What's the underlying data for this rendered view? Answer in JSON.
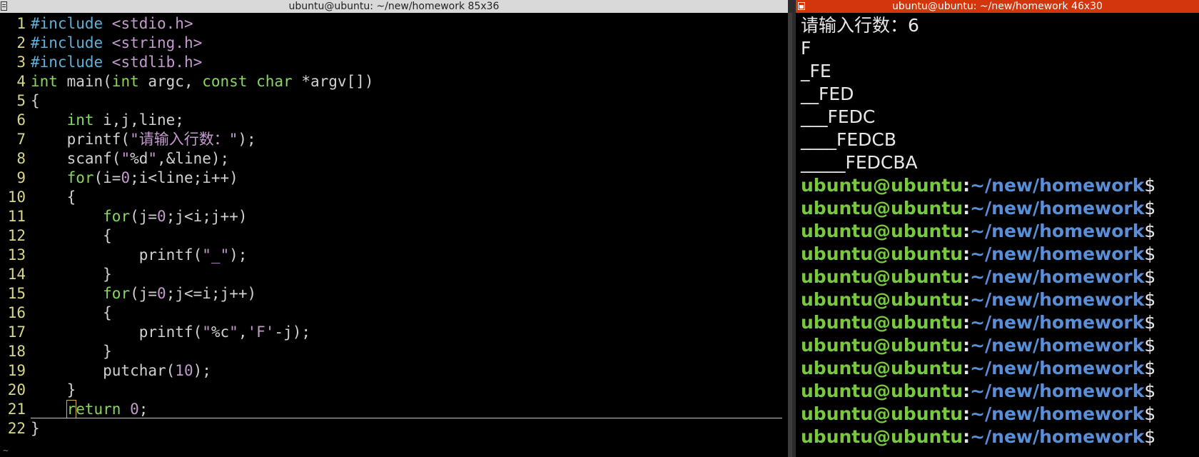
{
  "left_window": {
    "title": "ubuntu@ubuntu: ~/new/homework 85x36",
    "code_lines": [
      {
        "n": "1",
        "tokens": [
          {
            "t": "#include ",
            "c": "pre"
          },
          {
            "t": "<stdio.h>",
            "c": "str"
          }
        ]
      },
      {
        "n": "2",
        "tokens": [
          {
            "t": "#include ",
            "c": "pre"
          },
          {
            "t": "<string.h>",
            "c": "str"
          }
        ]
      },
      {
        "n": "3",
        "tokens": [
          {
            "t": "#include ",
            "c": "pre"
          },
          {
            "t": "<stdlib.h>",
            "c": "str"
          }
        ]
      },
      {
        "n": "4",
        "tokens": [
          {
            "t": "int",
            "c": "type"
          },
          {
            "t": " main(",
            "c": "plain"
          },
          {
            "t": "int",
            "c": "type"
          },
          {
            "t": " argc, ",
            "c": "plain"
          },
          {
            "t": "const",
            "c": "type"
          },
          {
            "t": " ",
            "c": "plain"
          },
          {
            "t": "char",
            "c": "type"
          },
          {
            "t": " *argv[])",
            "c": "plain"
          }
        ]
      },
      {
        "n": "5",
        "tokens": [
          {
            "t": "{",
            "c": "plain"
          }
        ]
      },
      {
        "n": "6",
        "tokens": [
          {
            "t": "    ",
            "c": "plain"
          },
          {
            "t": "int",
            "c": "type"
          },
          {
            "t": " i,j,line;",
            "c": "plain"
          }
        ]
      },
      {
        "n": "7",
        "tokens": [
          {
            "t": "    printf(",
            "c": "plain"
          },
          {
            "t": "\"请输入行数：\"",
            "c": "str"
          },
          {
            "t": ");",
            "c": "plain"
          }
        ]
      },
      {
        "n": "8",
        "tokens": [
          {
            "t": "    scanf(",
            "c": "plain"
          },
          {
            "t": "\"",
            "c": "str"
          },
          {
            "t": "%d",
            "c": "plain"
          },
          {
            "t": "\"",
            "c": "str"
          },
          {
            "t": ",&line);",
            "c": "plain"
          }
        ]
      },
      {
        "n": "9",
        "tokens": [
          {
            "t": "    ",
            "c": "plain"
          },
          {
            "t": "for",
            "c": "ctrl"
          },
          {
            "t": "(i=",
            "c": "plain"
          },
          {
            "t": "0",
            "c": "num"
          },
          {
            "t": ";i<line;i++)",
            "c": "plain"
          }
        ]
      },
      {
        "n": "10",
        "tokens": [
          {
            "t": "    {",
            "c": "plain"
          }
        ]
      },
      {
        "n": "11",
        "tokens": [
          {
            "t": "        ",
            "c": "plain"
          },
          {
            "t": "for",
            "c": "ctrl"
          },
          {
            "t": "(j=",
            "c": "plain"
          },
          {
            "t": "0",
            "c": "num"
          },
          {
            "t": ";j<i;j++)",
            "c": "plain"
          }
        ]
      },
      {
        "n": "12",
        "tokens": [
          {
            "t": "        {",
            "c": "plain"
          }
        ]
      },
      {
        "n": "13",
        "tokens": [
          {
            "t": "            printf(",
            "c": "plain"
          },
          {
            "t": "\"_\"",
            "c": "str"
          },
          {
            "t": ");",
            "c": "plain"
          }
        ]
      },
      {
        "n": "14",
        "tokens": [
          {
            "t": "        }",
            "c": "plain"
          }
        ]
      },
      {
        "n": "15",
        "tokens": [
          {
            "t": "        ",
            "c": "plain"
          },
          {
            "t": "for",
            "c": "ctrl"
          },
          {
            "t": "(j=",
            "c": "plain"
          },
          {
            "t": "0",
            "c": "num"
          },
          {
            "t": ";j<=i;j++)",
            "c": "plain"
          }
        ]
      },
      {
        "n": "16",
        "tokens": [
          {
            "t": "        {",
            "c": "plain"
          }
        ]
      },
      {
        "n": "17",
        "tokens": [
          {
            "t": "            printf(",
            "c": "plain"
          },
          {
            "t": "\"",
            "c": "str"
          },
          {
            "t": "%c",
            "c": "plain"
          },
          {
            "t": "\"",
            "c": "str"
          },
          {
            "t": ",",
            "c": "plain"
          },
          {
            "t": "'F'",
            "c": "str"
          },
          {
            "t": "-j);",
            "c": "plain"
          }
        ]
      },
      {
        "n": "18",
        "tokens": [
          {
            "t": "        }",
            "c": "plain"
          }
        ]
      },
      {
        "n": "19",
        "tokens": [
          {
            "t": "        putchar(",
            "c": "plain"
          },
          {
            "t": "10",
            "c": "num"
          },
          {
            "t": ");",
            "c": "plain"
          }
        ]
      },
      {
        "n": "20",
        "tokens": [
          {
            "t": "    }",
            "c": "plain"
          }
        ]
      },
      {
        "n": "21",
        "cursor": true,
        "tokens": [
          {
            "t": "    ",
            "c": "plain"
          },
          {
            "t": "r",
            "c": "ctrl",
            "cursor": true
          },
          {
            "t": "eturn",
            "c": "ctrl"
          },
          {
            "t": " ",
            "c": "plain"
          },
          {
            "t": "0",
            "c": "num"
          },
          {
            "t": ";",
            "c": "plain"
          }
        ]
      },
      {
        "n": "22",
        "tokens": [
          {
            "t": "}",
            "c": "plain"
          }
        ]
      }
    ],
    "tilde": "~"
  },
  "right_window": {
    "title": "ubuntu@ubuntu: ~/new/homework 46x30",
    "output_lines": [
      "请输入行数：6",
      "F",
      "_FE",
      "__FED",
      "___FEDC",
      "____FEDCB",
      "_____FEDCBA"
    ],
    "prompt": {
      "user": "ubuntu@ubuntu",
      "colon": ":",
      "path": "~/new/homework",
      "dollar": "$"
    },
    "prompt_count": 12
  },
  "colors": {
    "line_number": "#d7d78a",
    "preprocessor": "#5fafd7",
    "string": "#c39acd",
    "keyword": "#87d75f",
    "prompt_user": "#78c840",
    "prompt_path": "#5a8fd8",
    "right_title_bg": "#d3350d"
  }
}
